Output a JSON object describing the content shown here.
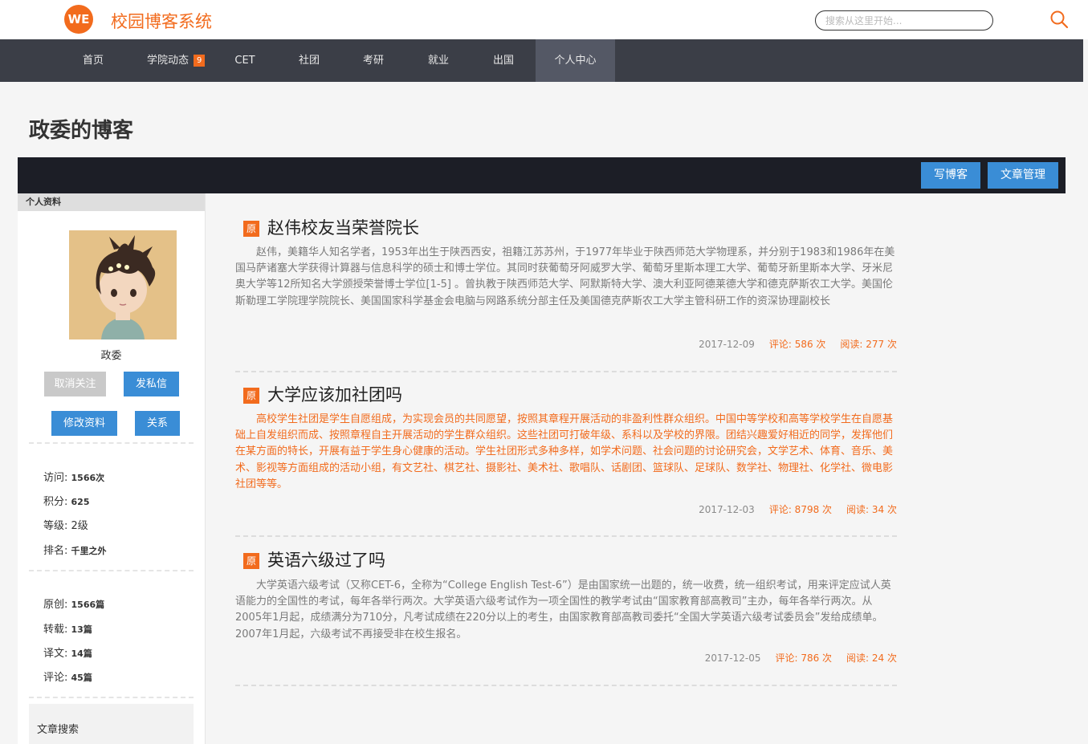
{
  "header": {
    "logo_text": "WE",
    "site_title": "校园博客系统",
    "search_placeholder": "搜索从这里开始..."
  },
  "nav": {
    "items": [
      {
        "label": "首页"
      },
      {
        "label": "学院动态",
        "badge": "9"
      },
      {
        "label": "CET"
      },
      {
        "label": "社团"
      },
      {
        "label": "考研"
      },
      {
        "label": "就业"
      },
      {
        "label": "出国"
      },
      {
        "label": "个人中心",
        "active": true
      }
    ]
  },
  "page": {
    "title": "政委的博客"
  },
  "toolbar": {
    "write_label": "写博客",
    "manage_label": "文章管理"
  },
  "sidebar": {
    "header": "个人资料",
    "username": "政委",
    "buttons": {
      "unfollow": "取消关注",
      "message": "发私信",
      "edit": "修改资料",
      "relation": "关系"
    },
    "stats": [
      {
        "label": "访问:",
        "value": "1566次"
      },
      {
        "label": "积分:",
        "value": "625"
      },
      {
        "label": "等级:",
        "value": "2级"
      },
      {
        "label": "排名:",
        "value": "千里之外"
      }
    ],
    "counts": [
      {
        "label": "原创:",
        "value": "1566篇"
      },
      {
        "label": "转载:",
        "value": "13篇"
      },
      {
        "label": "译文:",
        "value": "14篇"
      },
      {
        "label": "评论:",
        "value": "45篇"
      }
    ],
    "search_title": "文章搜索"
  },
  "articles": [
    {
      "tag": "原",
      "title": "赵伟校友当荣誉院长",
      "body": "赵伟，美籍华人知名学者，1953年出生于陕西西安，祖籍江苏苏州，于1977年毕业于陕西师范大学物理系，并分别于1983和1986年在美国马萨诸塞大学获得计算器与信息科学的硕士和博士学位。其同时获葡萄牙阿威罗大学、葡萄牙里斯本理工大学、葡萄牙新里斯本大学、牙米尼奥大学等12所知名大学颁授荣誉博士学位[1-5] 。曾执教于陕西师范大学、阿默斯特大学、澳大利亚阿德莱德大学和德克萨斯农工大学。美国伦斯勒理工学院理学院院长、美国国家科学基金会电脑与网路系统分部主任及美国德克萨斯农工大学主管科研工作的资深协理副校长",
      "date": "2017-12-09",
      "comments": "评论: 586 次",
      "reads": "阅读: 277 次"
    },
    {
      "tag": "原",
      "title": "大学应该加社团吗",
      "body": "高校学生社团是学生自愿组成，为实现会员的共同愿望，按照其章程开展活动的非盈利性群众组织。中国中等学校和高等学校学生在自愿基础上自发组织而成、按照章程自主开展活动的学生群众组织。这些社团可打破年级、系科以及学校的界限。团结兴趣爱好相近的同学，发挥他们在某方面的特长，开展有益于学生身心健康的活动。学生社团形式多种多样，如学术问题、社会问题的讨论研究会，文学艺术、体育、音乐、美术、影视等方面组成的活动小组，有文艺社、棋艺社、摄影社、美术社、歌唱队、话剧团、篮球队、足球队、数学社、物理社、化学社、微电影社团等等。",
      "date": "2017-12-03",
      "comments": "评论: 8798 次",
      "reads": "阅读: 34 次"
    },
    {
      "tag": "原",
      "title": "英语六级过了吗",
      "body": "大学英语六级考试（又称CET-6，全称为“College English Test-6”）是由国家统一出题的，统一收费，统一组织考试，用来评定应试人英语能力的全国性的考试，每年各举行两次。大学英语六级考试作为一项全国性的教学考试由“国家教育部高教司”主办，每年各举行两次。从2005年1月起，成绩满分为710分，凡考试成绩在220分以上的考生，由国家教育部高教司委托“全国大学英语六级考试委员会”发给成绩单。2007年1月起，六级考试不再接受非在校生报名。",
      "date": "2017-12-05",
      "comments": "评论: 786 次",
      "reads": "阅读: 24 次"
    }
  ],
  "colors": {
    "accent": "#f26b1d",
    "nav_bg": "#3b3e47",
    "button_blue": "#3a8dd6",
    "toolbar_bg": "#1c1e26"
  }
}
